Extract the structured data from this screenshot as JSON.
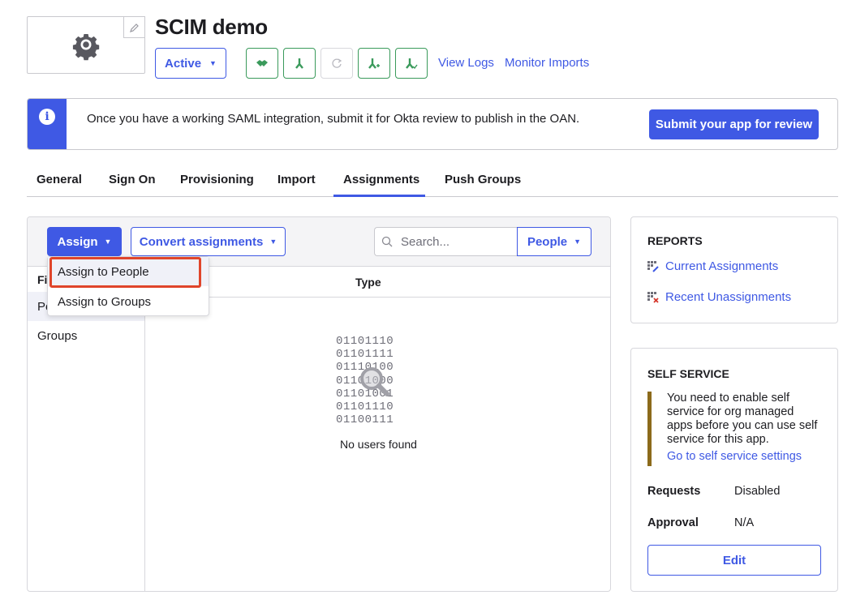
{
  "header": {
    "app_title": "SCIM demo",
    "status_label": "Active",
    "links": [
      "View Logs",
      "Monitor Imports"
    ],
    "tool_icons": [
      "handshake-icon",
      "user-arrow-icon",
      "refresh-icon",
      "user-plus-icon",
      "user-check-icon"
    ]
  },
  "banner": {
    "message": "Once you have a working SAML integration, submit it for Okta review to publish in the OAN.",
    "button": "Submit your app for review"
  },
  "tabs": [
    "General",
    "Sign On",
    "Provisioning",
    "Import",
    "Assignments",
    "Push Groups"
  ],
  "active_tab": "Assignments",
  "toolbar": {
    "assign_label": "Assign",
    "convert_label": "Convert assignments",
    "search_placeholder": "Search...",
    "people_label": "People"
  },
  "assign_menu": [
    "Assign to People",
    "Assign to Groups"
  ],
  "filters": {
    "heading": "Fil",
    "items": [
      "Pe",
      "Groups"
    ]
  },
  "table": {
    "column": "Type",
    "binary_lines": [
      "01101110",
      "01101111",
      "01110100",
      "01101000",
      "01101001",
      "01101110",
      "01100111"
    ],
    "empty_message": "No users found"
  },
  "reports": {
    "title": "REPORTS",
    "links": [
      "Current Assignments",
      "Recent Unassignments"
    ]
  },
  "self_service": {
    "title": "SELF SERVICE",
    "note": "You need to enable self service for org managed apps before you can use self service for this app.",
    "link": "Go to self service settings",
    "requests_label": "Requests",
    "requests_value": "Disabled",
    "approval_label": "Approval",
    "approval_value": "N/A",
    "edit_label": "Edit"
  },
  "colors": {
    "accent": "#3f59e4",
    "tool_green": "#3a9a5b",
    "highlight_red": "#e0452b",
    "note_bar": "#8c6a1b"
  }
}
